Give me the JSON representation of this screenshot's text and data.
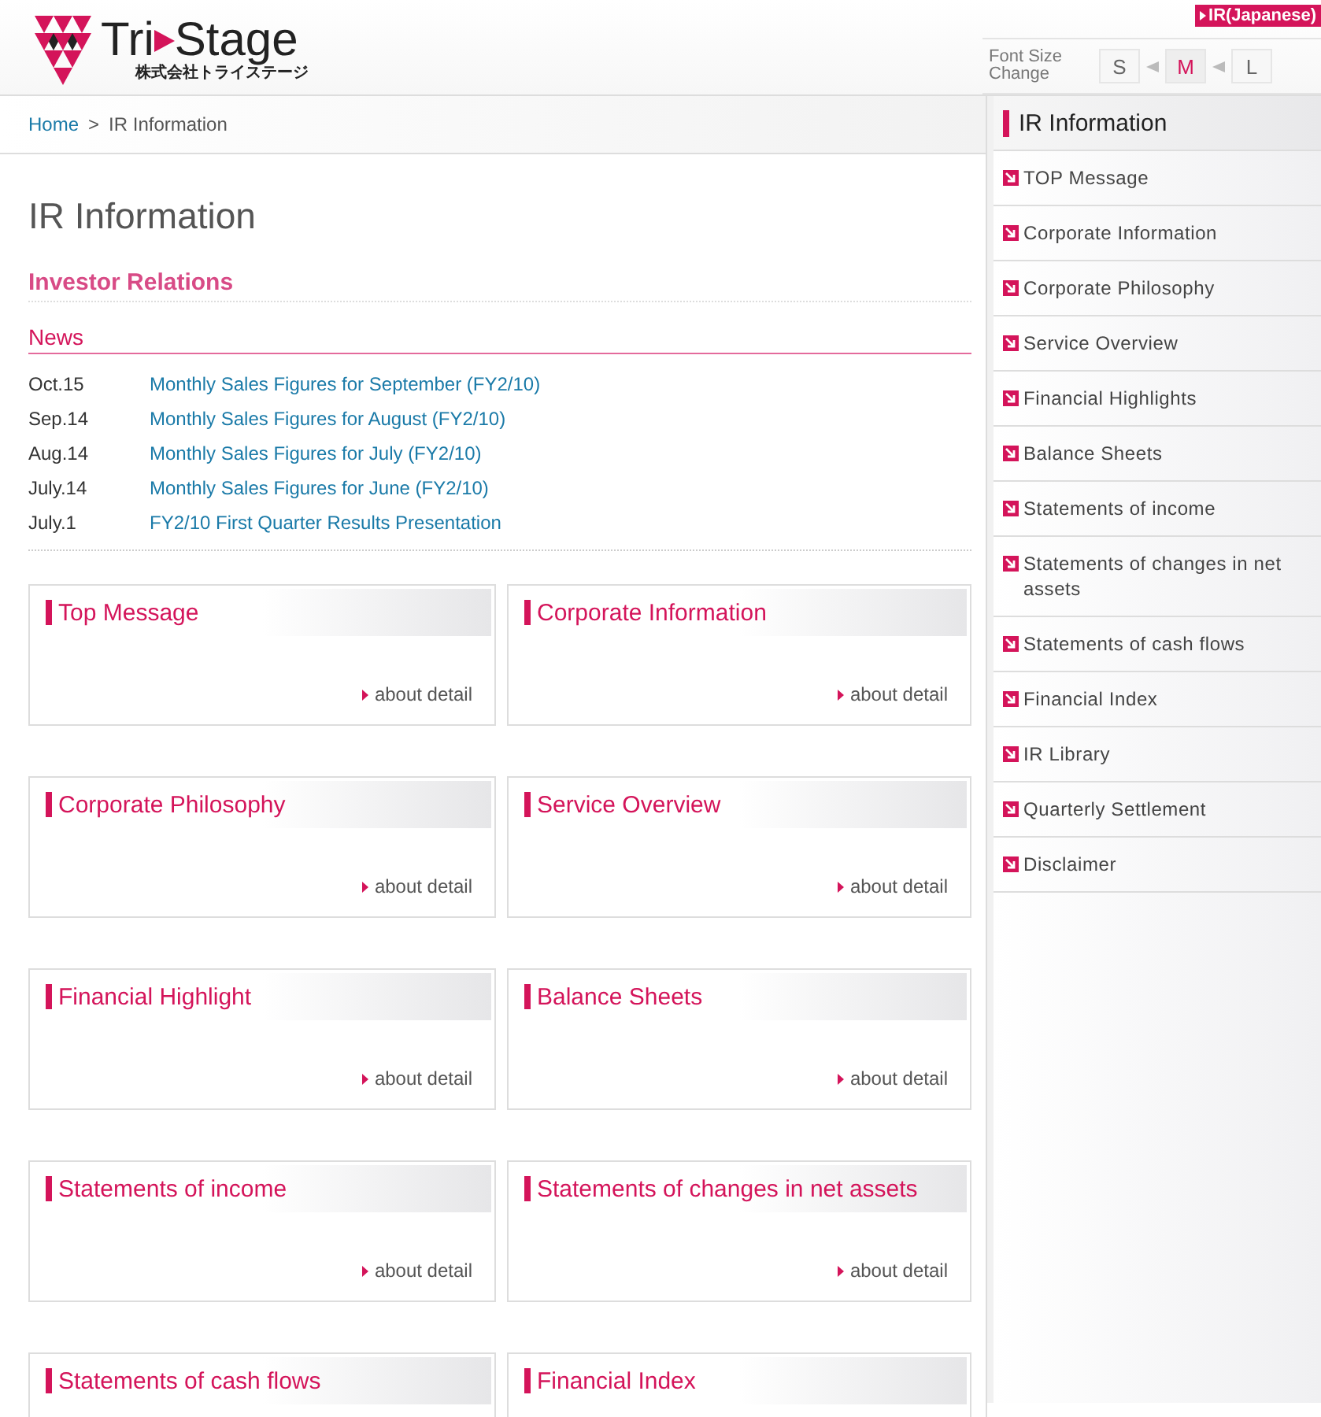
{
  "header": {
    "brand_left": "Tri",
    "brand_right": "Stage",
    "brand_sub": "株式会社トライステージ",
    "lang_link": "IR(Japanese)",
    "font_size_label": "Font Size Change",
    "font_sizes": [
      {
        "label": "S",
        "selected": false
      },
      {
        "label": "M",
        "selected": true
      },
      {
        "label": "L",
        "selected": false
      }
    ]
  },
  "breadcrumb": {
    "items": [
      "Home",
      "IR Information"
    ],
    "separator": ">"
  },
  "page_title": "IR Information",
  "section_title": "Investor Relations",
  "news": {
    "title": "News",
    "items": [
      {
        "date": "Oct.15",
        "text": "Monthly Sales Figures for September (FY2/10)"
      },
      {
        "date": "Sep.14",
        "text": "Monthly Sales Figures for August (FY2/10)"
      },
      {
        "date": "Aug.14",
        "text": "Monthly Sales Figures for July (FY2/10)"
      },
      {
        "date": "July.14",
        "text": "Monthly Sales Figures for June (FY2/10)"
      },
      {
        "date": "July.1",
        "text": "FY2/10 First Quarter Results Presentation"
      }
    ]
  },
  "cards": [
    {
      "title": "Top Message",
      "link": "about detail"
    },
    {
      "title": "Corporate Information",
      "link": "about detail"
    },
    {
      "title": "Corporate Philosophy",
      "link": "about detail"
    },
    {
      "title": "Service Overview",
      "link": "about detail"
    },
    {
      "title": "Financial Highlight",
      "link": "about detail"
    },
    {
      "title": "Balance Sheets",
      "link": "about detail"
    },
    {
      "title": "Statements of income",
      "link": "about detail"
    },
    {
      "title": "Statements of changes in net assets",
      "link": "about detail"
    },
    {
      "title": "Statements of cash flows"
    },
    {
      "title": "Financial Index"
    }
  ],
  "sidebar": {
    "title": "IR Information",
    "items": [
      "TOP Message",
      "Corporate Information",
      "Corporate Philosophy",
      "Service Overview",
      "Financial Highlights",
      "Balance Sheets",
      "Statements of income",
      "Statements of changes in net assets",
      "Statements of cash flows",
      "Financial Index",
      "IR Library",
      "Quarterly Settlement",
      "Disclaimer"
    ]
  }
}
